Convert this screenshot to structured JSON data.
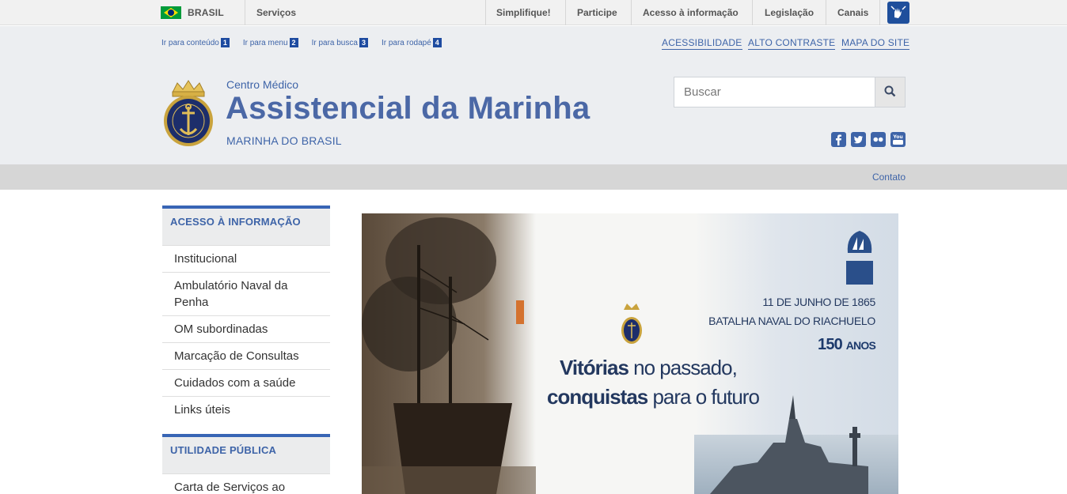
{
  "govbar": {
    "country": "BRASIL",
    "services": "Serviços",
    "links": [
      "Simplifique!",
      "Participe",
      "Acesso à informação",
      "Legislação",
      "Canais"
    ],
    "vlibras_icon": "sign-language-icon"
  },
  "header": {
    "skip_links": [
      {
        "label": "Ir para conteúdo",
        "num": "1"
      },
      {
        "label": "Ir para menu",
        "num": "2"
      },
      {
        "label": "Ir para busca",
        "num": "3"
      },
      {
        "label": "Ir para rodapé",
        "num": "4"
      }
    ],
    "top_links": [
      "ACESSIBILIDADE",
      "ALTO CONTRASTE",
      "MAPA DO SITE"
    ],
    "subtitle": "Centro Médico",
    "title": "Assistencial da Marinha",
    "owner": "MARINHA DO BRASIL",
    "search": {
      "placeholder": "Buscar",
      "icon": "search-icon"
    },
    "social": [
      {
        "name": "facebook-icon",
        "glyph": "f"
      },
      {
        "name": "twitter-icon",
        "glyph": "t"
      },
      {
        "name": "flickr-icon",
        "glyph": "••"
      },
      {
        "name": "youtube-icon",
        "glyph": "You"
      }
    ]
  },
  "servicebar": {
    "contato": "Contato"
  },
  "sidebar": {
    "section1": {
      "title": "ACESSO À INFORMAÇÃO",
      "items": [
        "Institucional",
        "Ambulatório Naval da Penha",
        "OM subordinadas",
        "Marcação de Consultas",
        "Cuidados com a saúde",
        "Links úteis"
      ]
    },
    "section2": {
      "title": "UTILIDADE PÚBLICA",
      "items": [
        "Carta de Serviços ao Usuário"
      ]
    }
  },
  "banner": {
    "date": "11 DE JUNHO DE 1865",
    "battle": "BATALHA NAVAL DO RIACHUELO",
    "years_num": "150",
    "years_word": "ANOS",
    "line1_strong": "Vitórias",
    "line1_rest": " no passado,",
    "line2_strong": "conquistas",
    "line2_rest": " para o futuro"
  },
  "colors": {
    "accent": "#3e64a8",
    "header_bg": "#eceef1",
    "title": "#4b68a6"
  }
}
